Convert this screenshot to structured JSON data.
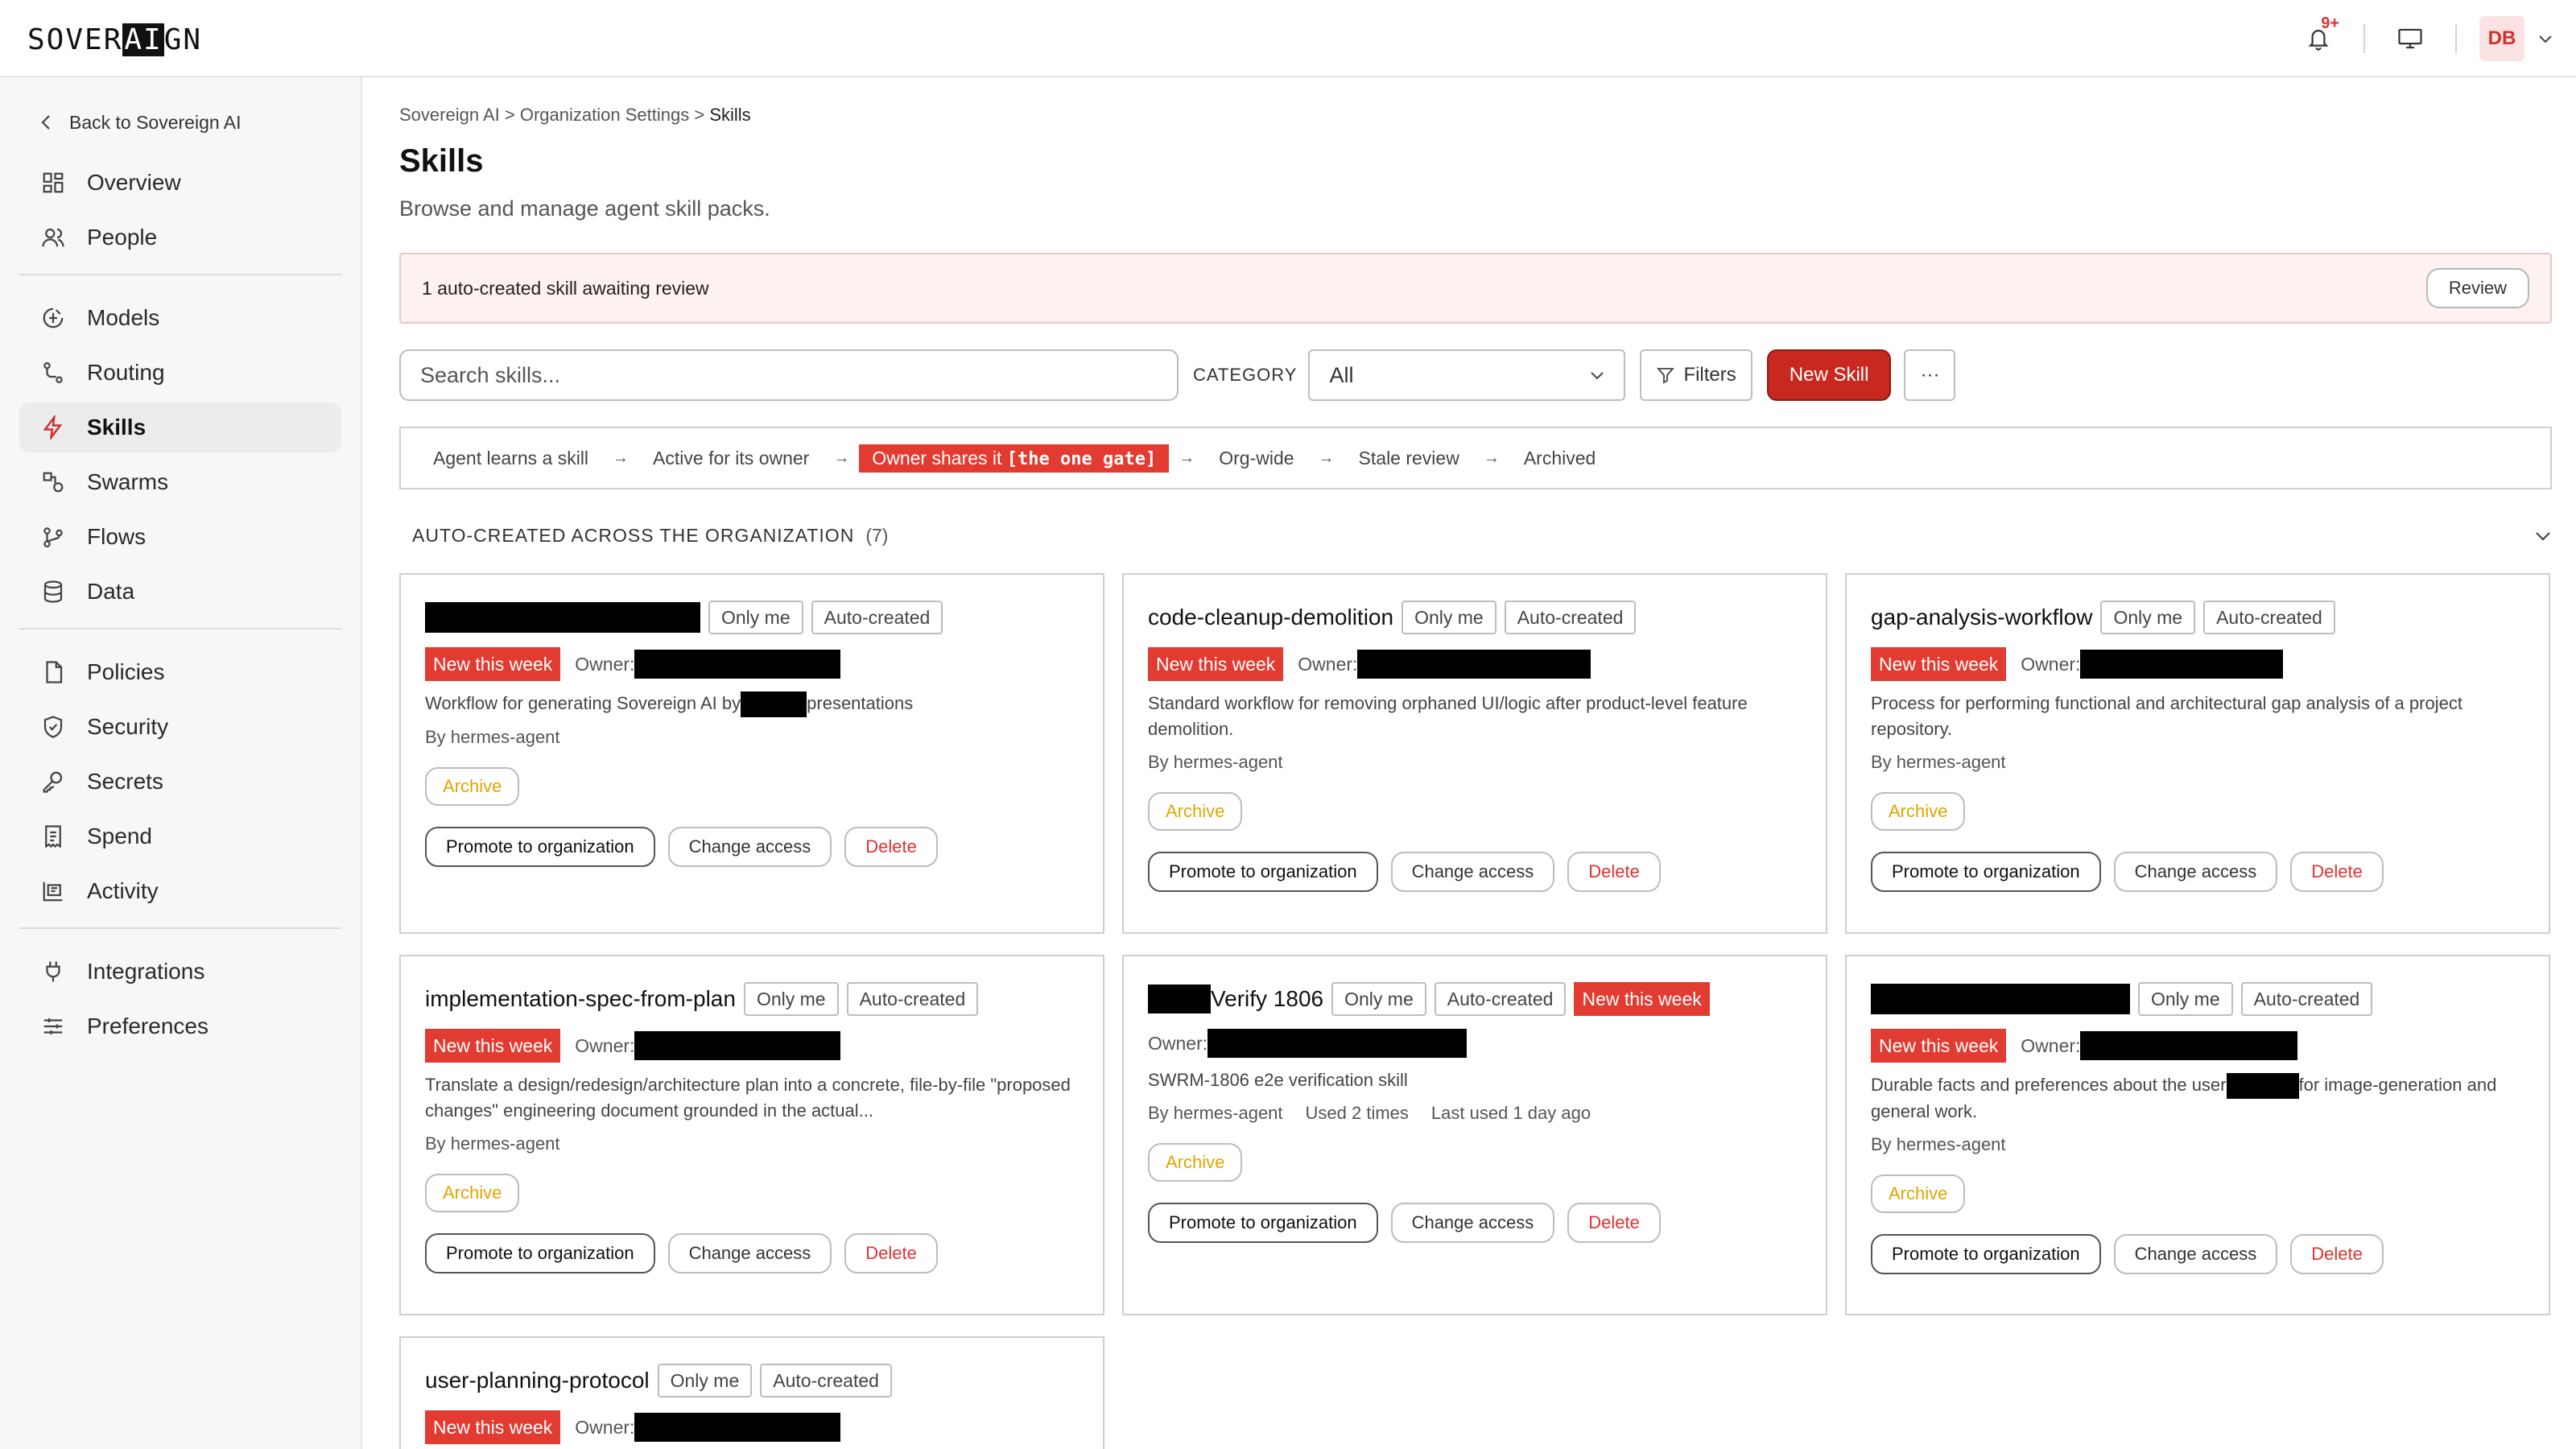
{
  "brand": {
    "logo_prefix": "SOVER",
    "logo_highlight": "AI",
    "logo_suffix": "GN"
  },
  "header": {
    "notification_badge": "9+",
    "avatar_initials": "DB"
  },
  "sidebar": {
    "back_label": "Back to Sovereign AI",
    "items": [
      {
        "label": "Overview",
        "icon": "overview-icon"
      },
      {
        "label": "People",
        "icon": "people-icon"
      },
      {
        "label": "Models",
        "icon": "models-icon"
      },
      {
        "label": "Routing",
        "icon": "routing-icon"
      },
      {
        "label": "Skills",
        "icon": "bolt-icon",
        "active": true
      },
      {
        "label": "Swarms",
        "icon": "swarms-icon"
      },
      {
        "label": "Flows",
        "icon": "flows-icon"
      },
      {
        "label": "Data",
        "icon": "database-icon"
      },
      {
        "label": "Policies",
        "icon": "policies-icon"
      },
      {
        "label": "Security",
        "icon": "shield-icon"
      },
      {
        "label": "Secrets",
        "icon": "key-icon"
      },
      {
        "label": "Spend",
        "icon": "spend-icon"
      },
      {
        "label": "Activity",
        "icon": "activity-icon"
      },
      {
        "label": "Integrations",
        "icon": "plug-icon"
      },
      {
        "label": "Preferences",
        "icon": "sliders-icon"
      }
    ]
  },
  "breadcrumb": {
    "root": "Sovereign AI",
    "sep": ">",
    "parent": "Organization Settings",
    "current": "Skills"
  },
  "page": {
    "title": "Skills",
    "subtitle": "Browse and manage agent skill packs."
  },
  "alert": {
    "text": "1 auto-created skill awaiting review",
    "button": "Review"
  },
  "toolbar": {
    "search_placeholder": "Search skills...",
    "category_label": "CATEGORY",
    "category_value": "All",
    "filters_label": "Filters",
    "new_skill_label": "New Skill",
    "more_label": "···"
  },
  "lifecycle": {
    "stages": [
      "Agent learns a skill",
      "Active for its owner",
      "Owner shares it",
      "Org-wide",
      "Stale review",
      "Archived"
    ],
    "gate_note": "[the one gate]",
    "arrow": "→"
  },
  "section": {
    "title": "AUTO-CREATED ACROSS THE ORGANIZATION",
    "count": "(7)"
  },
  "labels": {
    "only_me": "Only me",
    "auto_created": "Auto-created",
    "new_this_week": "New this week",
    "owner": "Owner:",
    "archive": "Archive",
    "promote": "Promote to organization",
    "change_access": "Change access",
    "delete": "Delete"
  },
  "cards": [
    {
      "name": "",
      "desc_a": "Workflow for generating Sovereign AI by",
      "desc_b": "presentations",
      "by": "By hermes-agent"
    },
    {
      "name": "code-cleanup-demolition",
      "desc": "Standard workflow for removing orphaned UI/logic after product-level feature demolition.",
      "by": "By hermes-agent"
    },
    {
      "name": "gap-analysis-workflow",
      "desc": "Process for performing functional and architectural gap analysis of a project repository.",
      "by": "By hermes-agent"
    },
    {
      "name": "implementation-spec-from-plan",
      "desc": "Translate a design/redesign/architecture plan into a concrete, file-by-file \"proposed changes\" engineering document grounded in the actual...",
      "by": "By hermes-agent"
    },
    {
      "name_suffix": "Verify 1806",
      "desc": "SWRM-1806 e2e verification skill",
      "by": "By hermes-agent",
      "used": "Used 2 times",
      "last_used": "Last used 1 day ago"
    },
    {
      "name": "",
      "desc_a": "Durable facts and preferences about the user",
      "desc_b": "for image-generation and general work.",
      "by": "By hermes-agent"
    },
    {
      "name": "user-planning-protocol"
    }
  ]
}
